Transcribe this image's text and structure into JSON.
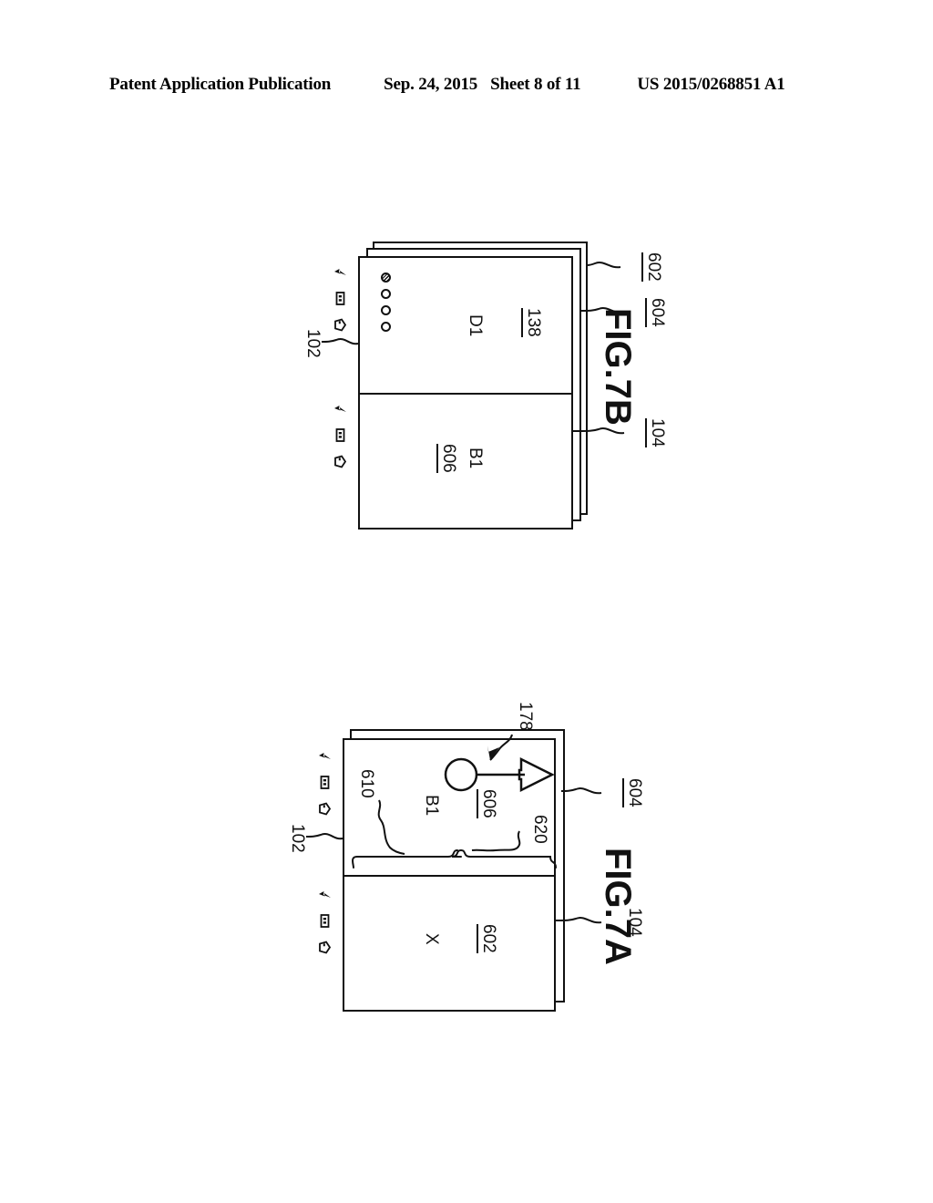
{
  "header": {
    "publication": "Patent Application Publication",
    "date": "Sep. 24, 2015",
    "sheet": "Sheet 8 of 11",
    "patent_number": "US 2015/0268851 A1"
  },
  "figures": [
    {
      "id": "fig7b",
      "caption": "FIG.7B",
      "device_ref": "102",
      "layers": [
        {
          "ref": "602",
          "kind": "background-card"
        },
        {
          "ref": "604",
          "kind": "background-card"
        },
        {
          "ref": "104",
          "kind": "device-display"
        }
      ],
      "panes": [
        {
          "name": "left-pane",
          "content_label": "D1",
          "ref": "138",
          "page_dots": [
            "filled",
            "hollow",
            "hollow",
            "hollow"
          ],
          "nav_icons": [
            "back-icon",
            "home-icon",
            "recents-icon"
          ]
        },
        {
          "name": "right-pane",
          "content_label": "B1",
          "ref": "606",
          "page_dots": [],
          "nav_icons": [
            "back-icon",
            "home-icon",
            "recents-icon"
          ]
        }
      ]
    },
    {
      "id": "fig7a",
      "caption": "FIG.7A",
      "device_ref": "102",
      "layers": [
        {
          "ref": "604",
          "kind": "background-card"
        },
        {
          "ref": "104",
          "kind": "device-display"
        }
      ],
      "panes": [
        {
          "name": "left-pane",
          "content_label": "B1",
          "ref": "606",
          "bracket_ref": "610",
          "page_dots": [],
          "nav_icons": [
            "back-icon",
            "home-icon",
            "recents-icon"
          ]
        },
        {
          "name": "right-pane",
          "content_label": "X",
          "ref": "602",
          "bracket_ref": "620",
          "page_dots": [],
          "nav_icons": [
            "back-icon",
            "home-icon",
            "recents-icon"
          ]
        }
      ],
      "gesture": {
        "ref": "178",
        "name": "drag-gesture-indicator",
        "description": "touch point with directional arrow"
      }
    }
  ],
  "colors": {
    "ink": "#111111",
    "paper": "#ffffff"
  }
}
